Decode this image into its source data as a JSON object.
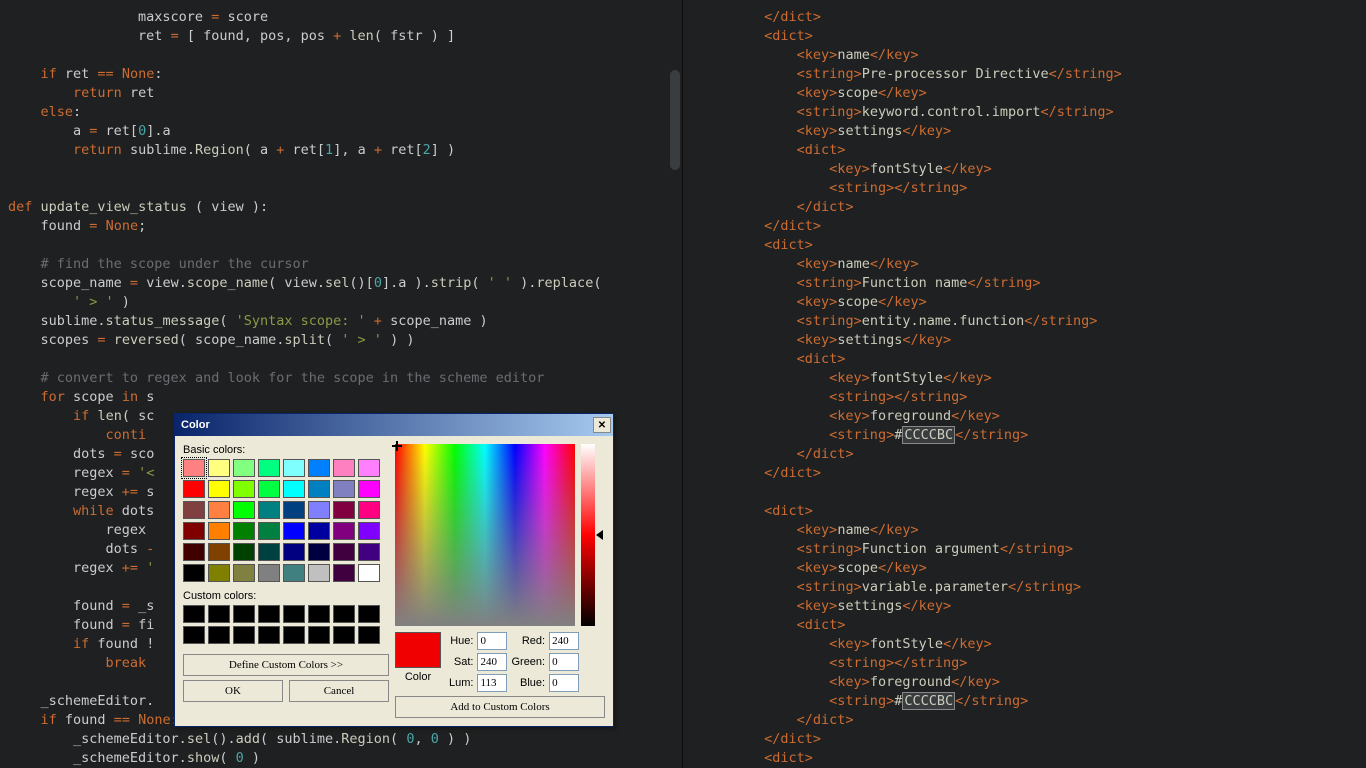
{
  "left_code_html": "                maxscore <span class='op'>=</span> score\n                ret <span class='op'>=</span> [ found, pos, pos <span class='op'>+</span> <span class='fn'>len</span>( fstr ) ]\n\n    <span class='kw'>if</span> ret <span class='op'>==</span> <span class='const'>None</span>:\n        <span class='kw'>return</span> ret\n    <span class='kw'>else</span>:\n        a <span class='op'>=</span> ret[<span class='num'>0</span>].a\n        <span class='kw'>return</span> sublime.<span class='fn'>Region</span>( a <span class='op'>+</span> ret[<span class='num'>1</span>], a <span class='op'>+</span> ret[<span class='num'>2</span>] )\n\n\n<span class='kw'>def</span> <span class='fn'>update_view_status</span> ( view ):\n    found <span class='op'>=</span> <span class='const'>None</span>;\n\n    <span class='cmt'># find the scope under the cursor</span>\n    scope_name <span class='op'>=</span> view.<span class='fn'>scope_name</span>( view.<span class='fn'>sel</span>()[<span class='num'>0</span>].a ).<span class='fn'>strip</span>( <span class='str'>' '</span> ).<span class='fn'>replace</span>(\n        <span class='str'>' &gt; '</span> )\n    sublime.<span class='fn'>status_message</span>( <span class='str'>'Syntax scope: '</span> <span class='op'>+</span> scope_name )\n    scopes <span class='op'>=</span> <span class='fn'>reversed</span>( scope_name.<span class='fn'>split</span>( <span class='str'>' &gt; '</span> ) )\n\n    <span class='cmt'># convert to regex and look for the scope in the scheme editor</span>\n    <span class='kw'>for</span> scope <span class='kw'>in</span> s\n        <span class='kw'>if</span> <span class='fn'>len</span>( sc\n            <span class='kw'>conti</span>\n        dots <span class='op'>=</span> sco\n        regex <span class='op'>=</span> <span class='str'>'&lt;</span>\n        regex <span class='op'>+=</span> s\n        <span class='kw'>while</span> dots\n            regex \n            dots <span class='op'>-</span>\n        regex <span class='op'>+=</span> <span class='str'>'</span>\n\n        found <span class='op'>=</span> _s\n        found <span class='op'>=</span> fi\n        <span class='kw'>if</span> found !\n            <span class='kw'>break</span>\n\n    _schemeEditor.\n    <span class='kw'>if</span> found <span class='op'>==</span> <span class='const'>None</span>:\n        _schemeEditor.<span class='fn'>sel</span>().<span class='fn'>add</span>( sublime.<span class='fn'>Region</span>( <span class='num'>0</span>, <span class='num'>0</span> ) )\n        _schemeEditor.<span class='fn'>show</span>( <span class='num'>0</span> )",
  "right_code_html": "         <span class='tag'>&lt;/dict&gt;</span>\n         <span class='tag'>&lt;dict&gt;</span>\n             <span class='tag'>&lt;key&gt;</span><span class='txt'>name</span><span class='tag'>&lt;/key&gt;</span>\n             <span class='tag'>&lt;string&gt;</span><span class='txt'>Pre-processor Directive</span><span class='tag'>&lt;/string&gt;</span>\n             <span class='tag'>&lt;key&gt;</span><span class='txt'>scope</span><span class='tag'>&lt;/key&gt;</span>\n             <span class='tag'>&lt;string&gt;</span><span class='txt'>keyword.control.import</span><span class='tag'>&lt;/string&gt;</span>\n             <span class='tag'>&lt;key&gt;</span><span class='txt'>settings</span><span class='tag'>&lt;/key&gt;</span>\n             <span class='tag'>&lt;dict&gt;</span>\n                 <span class='tag'>&lt;key&gt;</span><span class='txt'>fontStyle</span><span class='tag'>&lt;/key&gt;</span>\n                 <span class='tag'>&lt;string&gt;&lt;/string&gt;</span>\n             <span class='tag'>&lt;/dict&gt;</span>\n         <span class='tag'>&lt;/dict&gt;</span>\n         <span class='tag'>&lt;dict&gt;</span>\n             <span class='tag'>&lt;key&gt;</span><span class='txt'>name</span><span class='tag'>&lt;/key&gt;</span>\n             <span class='tag'>&lt;string&gt;</span><span class='txt'>Function name</span><span class='tag'>&lt;/string&gt;</span>\n             <span class='tag'>&lt;key&gt;</span><span class='txt'>scope</span><span class='tag'>&lt;/key&gt;</span>\n             <span class='tag'>&lt;string&gt;</span><span class='txt'>entity.name.function</span><span class='tag'>&lt;/string&gt;</span>\n             <span class='tag'>&lt;key&gt;</span><span class='txt'>settings</span><span class='tag'>&lt;/key&gt;</span>\n             <span class='tag'>&lt;dict&gt;</span>\n                 <span class='tag'>&lt;key&gt;</span><span class='txt'>fontStyle</span><span class='tag'>&lt;/key&gt;</span>\n                 <span class='tag'>&lt;string&gt;&lt;/string&gt;</span>\n                 <span class='tag'>&lt;key&gt;</span><span class='txt'>foreground</span><span class='tag'>&lt;/key&gt;</span>\n                 <span class='tag'>&lt;string&gt;</span><span class='txt'>#<span class='sel'>CCCCBC</span></span><span class='tag'>&lt;/string&gt;</span>\n             <span class='tag'>&lt;/dict&gt;</span>\n         <span class='tag'>&lt;/dict&gt;</span>\n\n         <span class='tag'>&lt;dict&gt;</span>\n             <span class='tag'>&lt;key&gt;</span><span class='txt'>name</span><span class='tag'>&lt;/key&gt;</span>\n             <span class='tag'>&lt;string&gt;</span><span class='txt'>Function argument</span><span class='tag'>&lt;/string&gt;</span>\n             <span class='tag'>&lt;key&gt;</span><span class='txt'>scope</span><span class='tag'>&lt;/key&gt;</span>\n             <span class='tag'>&lt;string&gt;</span><span class='txt'>variable.parameter</span><span class='tag'>&lt;/string&gt;</span>\n             <span class='tag'>&lt;key&gt;</span><span class='txt'>settings</span><span class='tag'>&lt;/key&gt;</span>\n             <span class='tag'>&lt;dict&gt;</span>\n                 <span class='tag'>&lt;key&gt;</span><span class='txt'>fontStyle</span><span class='tag'>&lt;/key&gt;</span>\n                 <span class='tag'>&lt;string&gt;&lt;/string&gt;</span>\n                 <span class='tag'>&lt;key&gt;</span><span class='txt'>foreground</span><span class='tag'>&lt;/key&gt;</span>\n                 <span class='tag'>&lt;string&gt;</span><span class='txt'>#<span class='sel'>CCCCBC</span></span><span class='tag'>&lt;/string&gt;</span>\n             <span class='tag'>&lt;/dict&gt;</span>\n         <span class='tag'>&lt;/dict&gt;</span>\n         <span class='tag'>&lt;dict&gt;</span>",
  "dialog": {
    "title": "Color",
    "basic_label": "Basic colors:",
    "custom_label": "Custom colors:",
    "define_btn": "Define Custom Colors >>",
    "ok_btn": "OK",
    "cancel_btn": "Cancel",
    "color_label": "Color",
    "add_btn": "Add to Custom Colors",
    "hue_label": "Hue:",
    "sat_label": "Sat:",
    "lum_label": "Lum:",
    "red_label": "Red:",
    "green_label": "Green:",
    "blue_label": "Blue:",
    "hue_val": "0",
    "sat_val": "240",
    "lum_val": "113",
    "red_val": "240",
    "green_val": "0",
    "blue_val": "0",
    "solid_color": "#f00000",
    "basic_colors": [
      "#ff8080",
      "#ffff80",
      "#80ff80",
      "#00ff80",
      "#80ffff",
      "#0080ff",
      "#ff80c0",
      "#ff80ff",
      "#ff0000",
      "#ffff00",
      "#80ff00",
      "#00ff40",
      "#00ffff",
      "#0080c0",
      "#8080c0",
      "#ff00ff",
      "#804040",
      "#ff8040",
      "#00ff00",
      "#008080",
      "#004080",
      "#8080ff",
      "#800040",
      "#ff0080",
      "#800000",
      "#ff8000",
      "#008000",
      "#008040",
      "#0000ff",
      "#0000a0",
      "#800080",
      "#8000ff",
      "#400000",
      "#804000",
      "#004000",
      "#004040",
      "#000080",
      "#000040",
      "#400040",
      "#400080",
      "#000000",
      "#808000",
      "#808040",
      "#808080",
      "#408080",
      "#c0c0c0",
      "#400040",
      "#ffffff"
    ],
    "selected_basic": 0,
    "custom_colors": [
      "#000",
      "#000",
      "#000",
      "#000",
      "#000",
      "#000",
      "#000",
      "#000",
      "#000",
      "#000",
      "#000",
      "#000",
      "#000",
      "#000",
      "#000",
      "#000"
    ]
  }
}
